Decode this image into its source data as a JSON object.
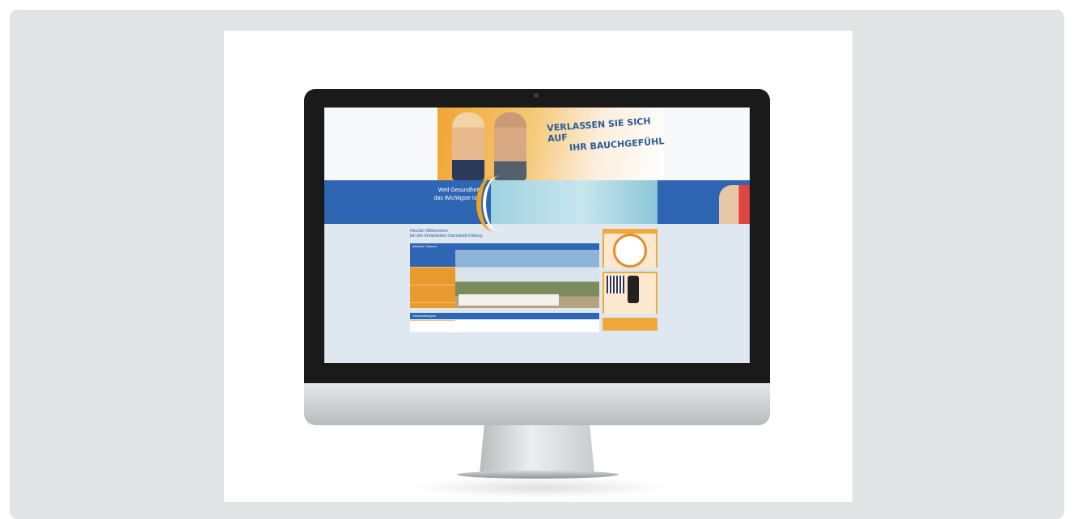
{
  "hero": {
    "headline_line1": "VERLASSEN SIE SICH AUF",
    "headline_line2": "IHR BAUCHGEFÜHL"
  },
  "band": {
    "slogan_line1": "Weil Gesundheit",
    "slogan_line2": "das Wichtigste ist."
  },
  "content": {
    "welcome_line1": "Herzlich Willkommen",
    "welcome_line2": "bei den Kreiskliniken Darmstadt-Dieburg",
    "news_title": "Aktuelle Themen",
    "events_title": "Veranstaltungen"
  },
  "colors": {
    "brand_blue": "#2e66b3",
    "brand_orange": "#f0a83b"
  }
}
